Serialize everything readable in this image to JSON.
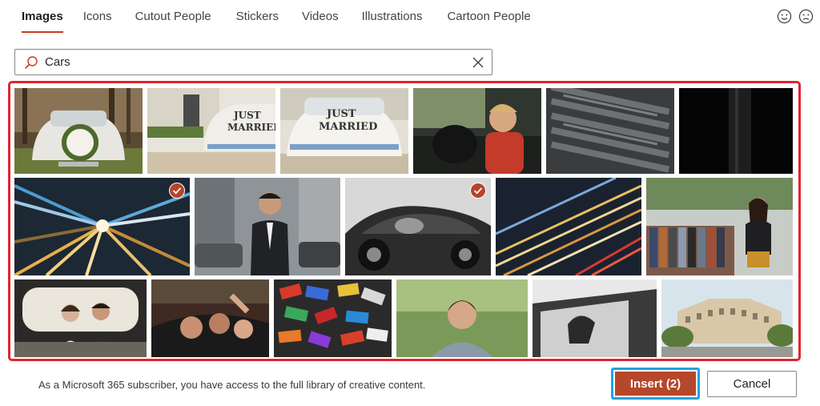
{
  "tabs": [
    {
      "label": "Images",
      "active": true
    },
    {
      "label": "Icons"
    },
    {
      "label": "Cutout People"
    },
    {
      "label": "Stickers"
    },
    {
      "label": "Videos"
    },
    {
      "label": "Illustrations"
    },
    {
      "label": "Cartoon People"
    }
  ],
  "feedback": {
    "smile_icon": "smile-icon",
    "frown_icon": "frown-icon"
  },
  "search": {
    "value": "Cars",
    "icon": "search-icon",
    "clear_icon": "close-icon"
  },
  "results": {
    "selected_count": 2,
    "images": [
      {
        "subject": "wedding-car-front-flowers",
        "selected": false
      },
      {
        "subject": "just-married-car-rear",
        "selected": false
      },
      {
        "subject": "just-married-car-rear-closeup",
        "selected": false
      },
      {
        "subject": "child-and-dog-in-car",
        "selected": false
      },
      {
        "subject": "aerial-parking-lot",
        "selected": false
      },
      {
        "subject": "dark-abstract",
        "selected": false
      },
      {
        "subject": "light-speed-tunnel",
        "selected": true
      },
      {
        "subject": "businessman-on-street",
        "selected": false
      },
      {
        "subject": "vintage-sports-car-bw",
        "selected": true
      },
      {
        "subject": "traffic-light-trails",
        "selected": false
      },
      {
        "subject": "woman-shopping-clothes-rack",
        "selected": false
      },
      {
        "subject": "couple-in-car-back-seat",
        "selected": false
      },
      {
        "subject": "people-in-convertible",
        "selected": false
      },
      {
        "subject": "toy-cars-pile",
        "selected": false
      },
      {
        "subject": "woman-portrait-outdoors",
        "selected": false
      },
      {
        "subject": "woman-in-car-window-bw",
        "selected": false
      },
      {
        "subject": "city-building-street",
        "selected": false
      }
    ]
  },
  "footer": {
    "note": "As a Microsoft 365 subscriber, you have access to the full library of creative content.",
    "insert_label": "Insert (2)",
    "cancel_label": "Cancel"
  },
  "colors": {
    "accent": "#b7472a",
    "highlight_frame": "#e0242e",
    "focus_ring": "#28a0dc"
  }
}
